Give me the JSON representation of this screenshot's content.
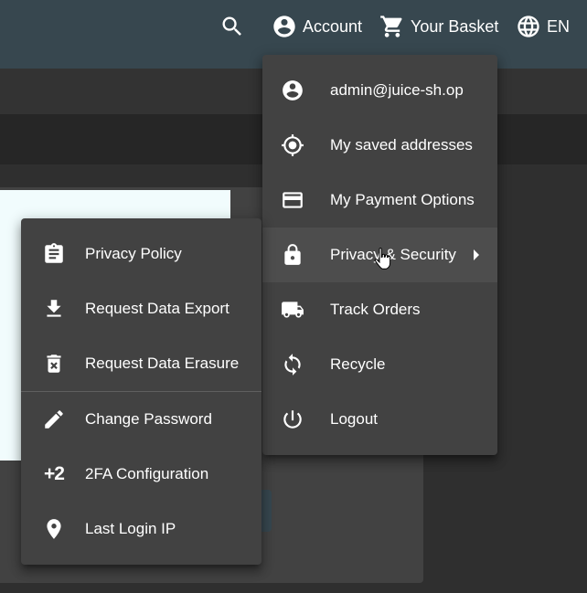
{
  "toolbar": {
    "account_label": "Account",
    "basket_label": "Your Basket",
    "language_label": "EN",
    "icons": [
      "search-icon",
      "account-circle-icon",
      "shopping-cart-icon",
      "globe-icon"
    ]
  },
  "account_menu": {
    "items": [
      {
        "label": "admin@juice-sh.op",
        "icon": "account-circle-icon"
      },
      {
        "label": "My saved addresses",
        "icon": "location-target-icon"
      },
      {
        "label": "My Payment Options",
        "icon": "credit-card-icon"
      },
      {
        "label": "Privacy & Security",
        "icon": "lock-icon",
        "highlighted": true
      },
      {
        "label": "Track Orders",
        "icon": "truck-icon"
      },
      {
        "label": "Recycle",
        "icon": "recycle-icon"
      },
      {
        "label": "Logout",
        "icon": "power-icon"
      }
    ]
  },
  "privacy_menu": {
    "items": [
      {
        "label": "Privacy Policy",
        "icon": "clipboard-icon"
      },
      {
        "label": "Request Data Export",
        "icon": "download-icon"
      },
      {
        "label": "Request Data Erasure",
        "icon": "delete-forever-icon"
      },
      {
        "label": "Change Password",
        "icon": "pencil-icon"
      },
      {
        "label": "2FA Configuration",
        "icon": "plus-two-icon",
        "glyph": "+2"
      },
      {
        "label": "Last Login IP",
        "icon": "map-pin-icon"
      }
    ]
  },
  "colors": {
    "toolbar": "#37474f",
    "menu_bg": "#424242",
    "menu_hover": "#4d4d4d",
    "page_bg": "#2f2f2f",
    "card_inner": "#f1fcfd"
  }
}
